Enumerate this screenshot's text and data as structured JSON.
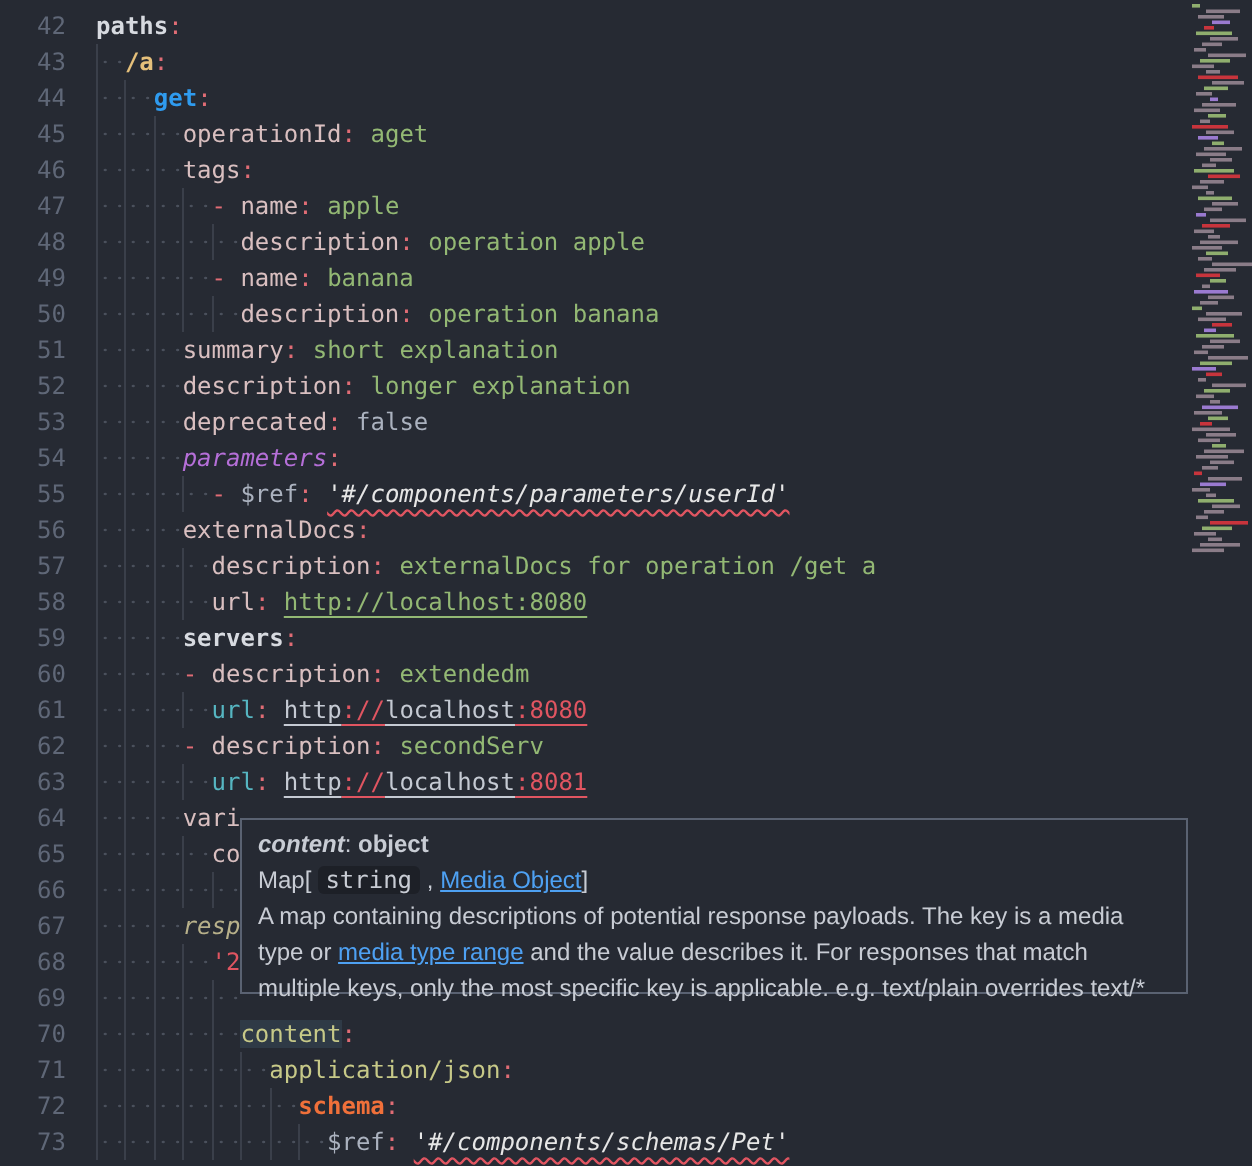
{
  "editor": {
    "lines": [
      {
        "number": "42",
        "tokens": [
          {
            "text": "paths",
            "kind": "key-bold"
          },
          {
            "text": ":",
            "kind": "punct"
          }
        ],
        "children": [
          {
            "number": "43",
            "tokens": [
              {
                "text": "/a",
                "kind": "path"
              },
              {
                "text": ":",
                "kind": "punct"
              }
            ],
            "children": [
              {
                "number": "44",
                "tokens": [
                  {
                    "text": "get",
                    "kind": "method"
                  },
                  {
                    "text": ":",
                    "kind": "punct"
                  }
                ],
                "children": [
                  {
                    "number": "45",
                    "tokens": [
                      {
                        "text": "operationId",
                        "kind": "key"
                      },
                      {
                        "text": ": ",
                        "kind": "punct"
                      },
                      {
                        "text": "aget",
                        "kind": "string"
                      }
                    ]
                  },
                  {
                    "number": "46",
                    "tokens": [
                      {
                        "text": "tags",
                        "kind": "key"
                      },
                      {
                        "text": ":",
                        "kind": "punct"
                      }
                    ],
                    "children": [
                      {
                        "number": "47",
                        "tokens": [
                          {
                            "text": "- ",
                            "kind": "dash"
                          },
                          {
                            "text": "name",
                            "kind": "key"
                          },
                          {
                            "text": ": ",
                            "kind": "punct"
                          },
                          {
                            "text": "apple",
                            "kind": "string"
                          }
                        ],
                        "children": [
                          {
                            "number": "48",
                            "tokens": [
                              {
                                "text": "description",
                                "kind": "key"
                              },
                              {
                                "text": ": ",
                                "kind": "punct"
                              },
                              {
                                "text": "operation apple",
                                "kind": "string"
                              }
                            ]
                          }
                        ]
                      },
                      {
                        "number": "49",
                        "tokens": [
                          {
                            "text": "- ",
                            "kind": "dash"
                          },
                          {
                            "text": "name",
                            "kind": "key"
                          },
                          {
                            "text": ": ",
                            "kind": "punct"
                          },
                          {
                            "text": "banana",
                            "kind": "string"
                          }
                        ],
                        "children": [
                          {
                            "number": "50",
                            "tokens": [
                              {
                                "text": "description",
                                "kind": "key"
                              },
                              {
                                "text": ": ",
                                "kind": "punct"
                              },
                              {
                                "text": "operation banana",
                                "kind": "string"
                              }
                            ]
                          }
                        ]
                      }
                    ]
                  },
                  {
                    "number": "51",
                    "tokens": [
                      {
                        "text": "summary",
                        "kind": "key"
                      },
                      {
                        "text": ": ",
                        "kind": "punct"
                      },
                      {
                        "text": "short explanation",
                        "kind": "string"
                      }
                    ]
                  },
                  {
                    "number": "52",
                    "tokens": [
                      {
                        "text": "description",
                        "kind": "key"
                      },
                      {
                        "text": ": ",
                        "kind": "punct"
                      },
                      {
                        "text": "longer explanation",
                        "kind": "string"
                      }
                    ]
                  },
                  {
                    "number": "53",
                    "tokens": [
                      {
                        "text": "deprecated",
                        "kind": "key"
                      },
                      {
                        "text": ": ",
                        "kind": "punct"
                      },
                      {
                        "text": "false",
                        "kind": "literal"
                      }
                    ]
                  },
                  {
                    "number": "54",
                    "tokens": [
                      {
                        "text": "parameters",
                        "kind": "key-special"
                      },
                      {
                        "text": ":",
                        "kind": "punct"
                      }
                    ],
                    "children": [
                      {
                        "number": "55",
                        "tokens": [
                          {
                            "text": "- ",
                            "kind": "dash"
                          },
                          {
                            "text": "$ref",
                            "kind": "ref-key"
                          },
                          {
                            "text": ": ",
                            "kind": "punct"
                          },
                          {
                            "text": "'#/components/parameters/userId'",
                            "kind": "ref"
                          }
                        ]
                      }
                    ]
                  },
                  {
                    "number": "56",
                    "tokens": [
                      {
                        "text": "externalDocs",
                        "kind": "key"
                      },
                      {
                        "text": ":",
                        "kind": "punct"
                      }
                    ],
                    "children": [
                      {
                        "number": "57",
                        "tokens": [
                          {
                            "text": "description",
                            "kind": "key"
                          },
                          {
                            "text": ": ",
                            "kind": "punct"
                          },
                          {
                            "text": "externalDocs for operation /get a",
                            "kind": "string"
                          }
                        ]
                      },
                      {
                        "number": "58",
                        "tokens": [
                          {
                            "text": "url",
                            "kind": "key"
                          },
                          {
                            "text": ": ",
                            "kind": "punct"
                          },
                          {
                            "text": "http://localhost:8080",
                            "kind": "url"
                          }
                        ]
                      }
                    ]
                  },
                  {
                    "number": "59",
                    "tokens": [
                      {
                        "text": "servers",
                        "kind": "key-bold"
                      },
                      {
                        "text": ":",
                        "kind": "punct"
                      }
                    ]
                  },
                  {
                    "number": "60",
                    "tokens": [
                      {
                        "text": "- ",
                        "kind": "dash"
                      },
                      {
                        "text": "description",
                        "kind": "key"
                      },
                      {
                        "text": ": ",
                        "kind": "punct"
                      },
                      {
                        "text": "extendedm",
                        "kind": "string"
                      }
                    ],
                    "children": [
                      {
                        "number": "61",
                        "tokens": [
                          {
                            "text": "url",
                            "kind": "key-url"
                          },
                          {
                            "text": ": ",
                            "kind": "punct"
                          },
                          {
                            "text": "http",
                            "kind": "url-alt"
                          },
                          {
                            "text": "://",
                            "kind": "url-red"
                          },
                          {
                            "text": "localhost",
                            "kind": "url-alt"
                          },
                          {
                            "text": ":8080",
                            "kind": "url-red"
                          }
                        ]
                      }
                    ]
                  },
                  {
                    "number": "62",
                    "tokens": [
                      {
                        "text": "- ",
                        "kind": "dash"
                      },
                      {
                        "text": "description",
                        "kind": "key"
                      },
                      {
                        "text": ": ",
                        "kind": "punct"
                      },
                      {
                        "text": "secondServ",
                        "kind": "string"
                      }
                    ],
                    "children": [
                      {
                        "number": "63",
                        "tokens": [
                          {
                            "text": "url",
                            "kind": "key-url"
                          },
                          {
                            "text": ": ",
                            "kind": "punct"
                          },
                          {
                            "text": "http",
                            "kind": "url-alt"
                          },
                          {
                            "text": "://",
                            "kind": "url-red"
                          },
                          {
                            "text": "localhost",
                            "kind": "url-alt"
                          },
                          {
                            "text": ":8081",
                            "kind": "url-red"
                          }
                        ]
                      }
                    ]
                  },
                  {
                    "number": "64",
                    "tokens": [
                      {
                        "text": "vari",
                        "kind": "key"
                      }
                    ],
                    "children": [
                      {
                        "number": "65",
                        "tokens": [
                          {
                            "text": "co",
                            "kind": "key"
                          }
                        ],
                        "children": [
                          {
                            "number": "66"
                          }
                        ]
                      }
                    ]
                  },
                  {
                    "number": "67",
                    "tokens": [
                      {
                        "text": "resp",
                        "kind": "key-muted"
                      }
                    ],
                    "children": [
                      {
                        "number": "68",
                        "tokens": [
                          {
                            "text": "'2",
                            "kind": "quoted"
                          }
                        ],
                        "children": [
                          {
                            "number": "69"
                          },
                          {
                            "number": "70",
                            "tokens": [
                              {
                                "text": "content",
                                "kind": "hover-key"
                              },
                              {
                                "text": ":",
                                "kind": "punct"
                              }
                            ],
                            "children": [
                              {
                                "number": "71",
                                "tokens": [
                                  {
                                    "text": "application/json",
                                    "kind": "key-media"
                                  },
                                  {
                                    "text": ":",
                                    "kind": "punct"
                                  }
                                ],
                                "children": [
                                  {
                                    "number": "72",
                                    "tokens": [
                                      {
                                        "text": "schema",
                                        "kind": "key-schema"
                                      },
                                      {
                                        "text": ":",
                                        "kind": "punct"
                                      }
                                    ],
                                    "children": [
                                      {
                                        "number": "73",
                                        "tokens": [
                                          {
                                            "text": "$ref",
                                            "kind": "ref-key"
                                          },
                                          {
                                            "text": ": ",
                                            "kind": "punct"
                                          },
                                          {
                                            "text": "'#/components/schemas/Pet'",
                                            "kind": "ref"
                                          }
                                        ]
                                      }
                                    ]
                                  }
                                ]
                              }
                            ]
                          }
                        ]
                      }
                    ]
                  }
                ]
              }
            ]
          }
        ]
      }
    ]
  },
  "hover": {
    "title": [
      {
        "text": "content",
        "kind": "italic-bold"
      },
      {
        "text": ": ",
        "kind": "text"
      },
      {
        "text": "object",
        "kind": "bold"
      }
    ],
    "type": [
      {
        "text": "Map[",
        "kind": "text"
      },
      {
        "text": "string",
        "kind": "code"
      },
      {
        "text": " , ",
        "kind": "text"
      },
      {
        "text": "Media Object",
        "kind": "link"
      },
      {
        "text": "]",
        "kind": "text"
      }
    ],
    "description": [
      {
        "text": "A map containing descriptions of potential response payloads. The key is a media type or ",
        "kind": "text"
      },
      {
        "text": "media type range",
        "kind": "link"
      },
      {
        "text": " and the value describes it. For responses that match multiple keys, only the most specific key is applicable. e.g. text/plain overrides text/*",
        "kind": "text"
      }
    ]
  }
}
